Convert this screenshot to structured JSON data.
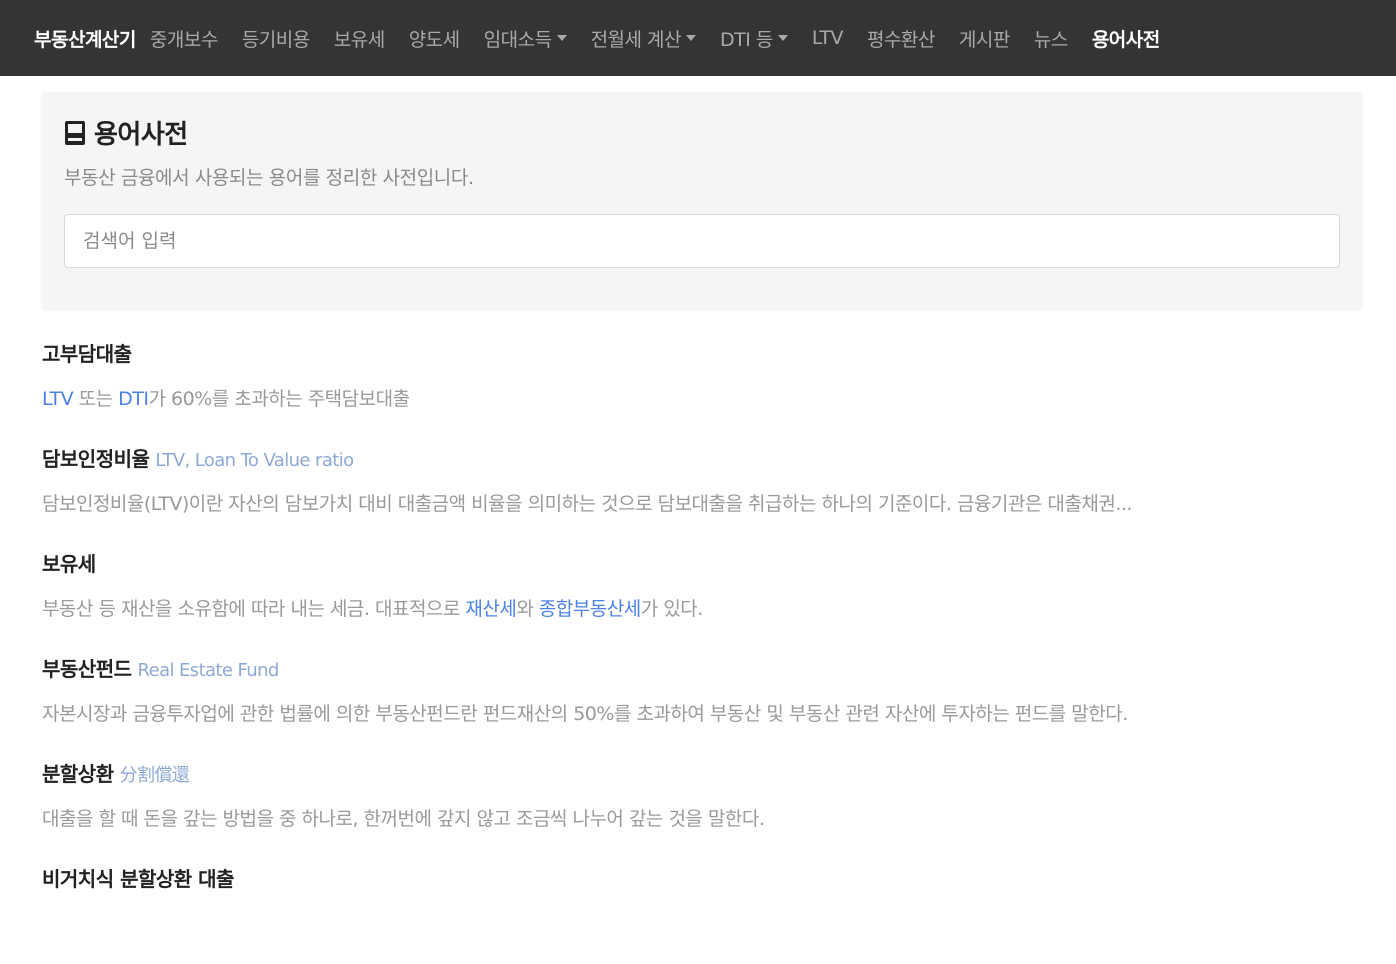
{
  "nav": {
    "brand": "부동산계산기",
    "items": [
      {
        "label": "중개보수",
        "dropdown": false,
        "active": false
      },
      {
        "label": "등기비용",
        "dropdown": false,
        "active": false
      },
      {
        "label": "보유세",
        "dropdown": false,
        "active": false
      },
      {
        "label": "양도세",
        "dropdown": false,
        "active": false
      },
      {
        "label": "임대소득",
        "dropdown": true,
        "active": false
      },
      {
        "label": "전월세 계산",
        "dropdown": true,
        "active": false
      },
      {
        "label": "DTI 등",
        "dropdown": true,
        "active": false
      },
      {
        "label": "LTV",
        "dropdown": false,
        "active": false
      },
      {
        "label": "평수환산",
        "dropdown": false,
        "active": false
      },
      {
        "label": "게시판",
        "dropdown": false,
        "active": false
      },
      {
        "label": "뉴스",
        "dropdown": false,
        "active": false
      },
      {
        "label": "용어사전",
        "dropdown": false,
        "active": true
      }
    ]
  },
  "header": {
    "title": "용어사전",
    "description": "부동산 금융에서 사용되는 용어를 정리한 사전입니다.",
    "icon": "book-icon"
  },
  "search": {
    "placeholder": "검색어 입력",
    "value": ""
  },
  "terms": [
    {
      "title": "고부담대출",
      "subtitle": "",
      "desc": [
        {
          "text": "LTV",
          "link": true
        },
        {
          "text": " 또는 ",
          "link": false
        },
        {
          "text": "DTI",
          "link": true
        },
        {
          "text": "가 60%를 초과하는 주택담보대출",
          "link": false
        }
      ]
    },
    {
      "title": "담보인정비율",
      "subtitle": "LTV, Loan To Value ratio",
      "desc": [
        {
          "text": "담보인정비율(LTV)이란 자산의 담보가치 대비 대출금액 비율을 의미하는 것으로 담보대출을 취급하는 하나의 기준이다. 금융기관은 대출채권...",
          "link": false
        }
      ]
    },
    {
      "title": "보유세",
      "subtitle": "",
      "desc": [
        {
          "text": "부동산 등 재산을 소유함에 따라 내는 세금. 대표적으로 ",
          "link": false
        },
        {
          "text": "재산세",
          "link": true
        },
        {
          "text": "와 ",
          "link": false
        },
        {
          "text": "종합부동산세",
          "link": true
        },
        {
          "text": "가 있다.",
          "link": false
        }
      ]
    },
    {
      "title": "부동산펀드",
      "subtitle": "Real Estate Fund",
      "desc": [
        {
          "text": "자본시장과 금융투자업에 관한 법률에 의한 부동산펀드란 펀드재산의 50%를 초과하여 부동산 및 부동산 관련 자산에 투자하는 펀드를 말한다.",
          "link": false
        }
      ]
    },
    {
      "title": "분할상환",
      "subtitle": "分割償還",
      "desc": [
        {
          "text": "대출을 할 때 돈을 갚는 방법을 중 하나로, 한꺼번에 갚지 않고 조금씩 나누어 갚는 것을 말한다.",
          "link": false
        }
      ]
    },
    {
      "title": "비거치식 분할상환 대출",
      "subtitle": "",
      "desc": []
    }
  ]
}
